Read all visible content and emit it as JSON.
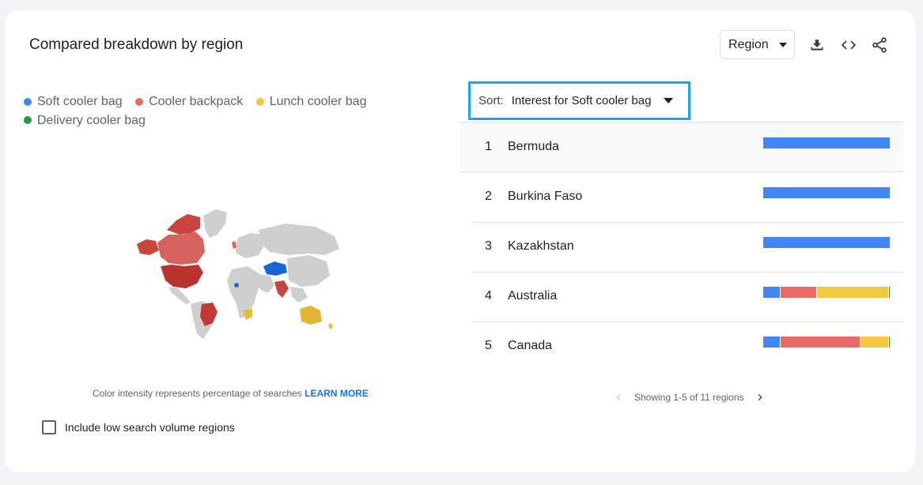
{
  "header": {
    "title": "Compared breakdown by region",
    "region_select": "Region",
    "icons": [
      "download-icon",
      "embed-code-icon",
      "share-icon"
    ]
  },
  "legend": [
    {
      "label": "Soft cooler bag",
      "color": "#4285f4"
    },
    {
      "label": "Cooler backpack",
      "color": "#ea6b66"
    },
    {
      "label": "Lunch cooler bag",
      "color": "#f5c842"
    },
    {
      "label": "Delivery cooler bag",
      "color": "#1e9e3e"
    }
  ],
  "footnote": {
    "text": "Color intensity represents percentage of searches",
    "link": "LEARN MORE"
  },
  "checkbox": {
    "label": "Include low search volume regions",
    "checked": false
  },
  "sort": {
    "label": "Sort:",
    "value": "Interest for Soft cooler bag"
  },
  "rows": [
    {
      "rank": "1",
      "name": "Bermuda",
      "shares": [
        1,
        0,
        0,
        0
      ]
    },
    {
      "rank": "2",
      "name": "Burkina Faso",
      "shares": [
        1,
        0,
        0,
        0
      ]
    },
    {
      "rank": "3",
      "name": "Kazakhstan",
      "shares": [
        1,
        0,
        0,
        0
      ]
    },
    {
      "rank": "4",
      "name": "Australia",
      "shares": [
        0.13,
        0.29,
        0.57,
        0.01
      ]
    },
    {
      "rank": "5",
      "name": "Canada",
      "shares": [
        0.13,
        0.63,
        0.23,
        0.01
      ]
    }
  ],
  "pager": {
    "text": "Showing 1-5 of 11 regions"
  }
}
